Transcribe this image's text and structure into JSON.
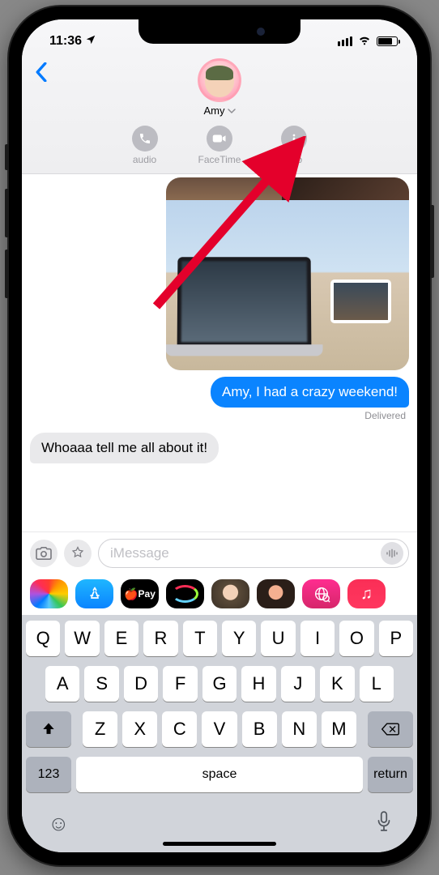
{
  "status": {
    "time": "11:36",
    "loc_icon": "location-arrow"
  },
  "header": {
    "contact_name": "Amy",
    "actions": {
      "audio": "audio",
      "facetime": "FaceTime",
      "info": "info"
    }
  },
  "messages": {
    "sent_text": "Amy, I had a crazy weekend!",
    "delivered_label": "Delivered",
    "received_text": "Whoaaa tell me all about it!"
  },
  "composer": {
    "placeholder": "iMessage"
  },
  "apps": {
    "pay_label": "Pay"
  },
  "keyboard": {
    "row1": [
      "Q",
      "W",
      "E",
      "R",
      "T",
      "Y",
      "U",
      "I",
      "O",
      "P"
    ],
    "row2": [
      "A",
      "S",
      "D",
      "F",
      "G",
      "H",
      "J",
      "K",
      "L"
    ],
    "row3": [
      "Z",
      "X",
      "C",
      "V",
      "B",
      "N",
      "M"
    ],
    "numbers": "123",
    "space": "space",
    "return": "return"
  },
  "annotation": {
    "arrow_color": "#e4002b"
  }
}
